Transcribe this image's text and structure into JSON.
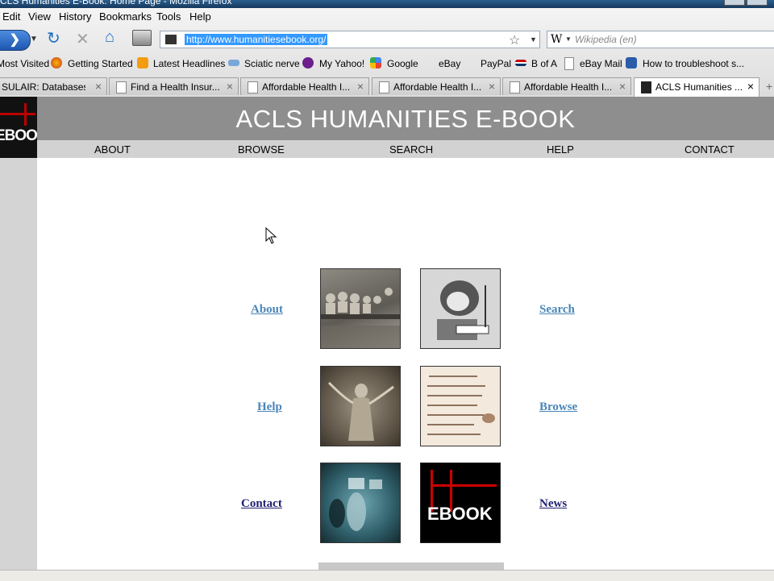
{
  "window": {
    "title": "CLS Humanities E-Book: Home Page - Mozilla Firefox"
  },
  "menu": {
    "items": [
      {
        "label": "Edit"
      },
      {
        "label": "View"
      },
      {
        "label": "History"
      },
      {
        "label": "Bookmarks"
      },
      {
        "label": "Tools"
      },
      {
        "label": "Help"
      }
    ]
  },
  "urlbar": {
    "url": "http://www.humanitiesebook.org/"
  },
  "search": {
    "engine_icon": "W",
    "placeholder": "Wikipedia (en)"
  },
  "bookmarks": [
    {
      "label": "Most Visited",
      "icon": "most-visited-icon"
    },
    {
      "label": "Getting Started",
      "icon": "firefox-icon"
    },
    {
      "label": "Latest Headlines",
      "icon": "rss-icon"
    },
    {
      "label": "Sciatic nerve",
      "icon": "page-icon"
    },
    {
      "label": "My Yahoo!",
      "icon": "yahoo-icon"
    },
    {
      "label": "Google",
      "icon": "google-icon"
    },
    {
      "label": "eBay",
      "icon": "ebay-icon"
    },
    {
      "label": "PayPal",
      "icon": "paypal-icon"
    },
    {
      "label": "B of A",
      "icon": "bofa-icon"
    },
    {
      "label": "eBay Mail",
      "icon": "page-icon"
    },
    {
      "label": "How to troubleshoot s...",
      "icon": "microsoft-icon"
    }
  ],
  "tabs": [
    {
      "label": "SULAIR: Databases ...",
      "active": false
    },
    {
      "label": "Find a Health Insur...",
      "active": false
    },
    {
      "label": "Affordable Health I...",
      "active": false
    },
    {
      "label": "Affordable Health I...",
      "active": false
    },
    {
      "label": "Affordable Health I...",
      "active": false
    },
    {
      "label": "ACLS Humanities ...",
      "active": true
    }
  ],
  "site": {
    "logo_text": "EBOOK",
    "title": "ACLS HUMANITIES E-BOOK",
    "nav": [
      "ABOUT",
      "BROWSE",
      "SEARCH",
      "HELP",
      "CONTACT"
    ],
    "links": {
      "about": "About",
      "search": "Search",
      "help": "Help",
      "browse": "Browse",
      "contact": "Contact",
      "news": "News"
    },
    "ebook_tile_text": "EBOOK"
  },
  "colors": {
    "header_bg": "#8e8e8e",
    "nav_bg": "#d2d2d2",
    "link_blue": "#4a86b8",
    "link_navy": "#1f1f70",
    "logo_red": "#b00000"
  }
}
